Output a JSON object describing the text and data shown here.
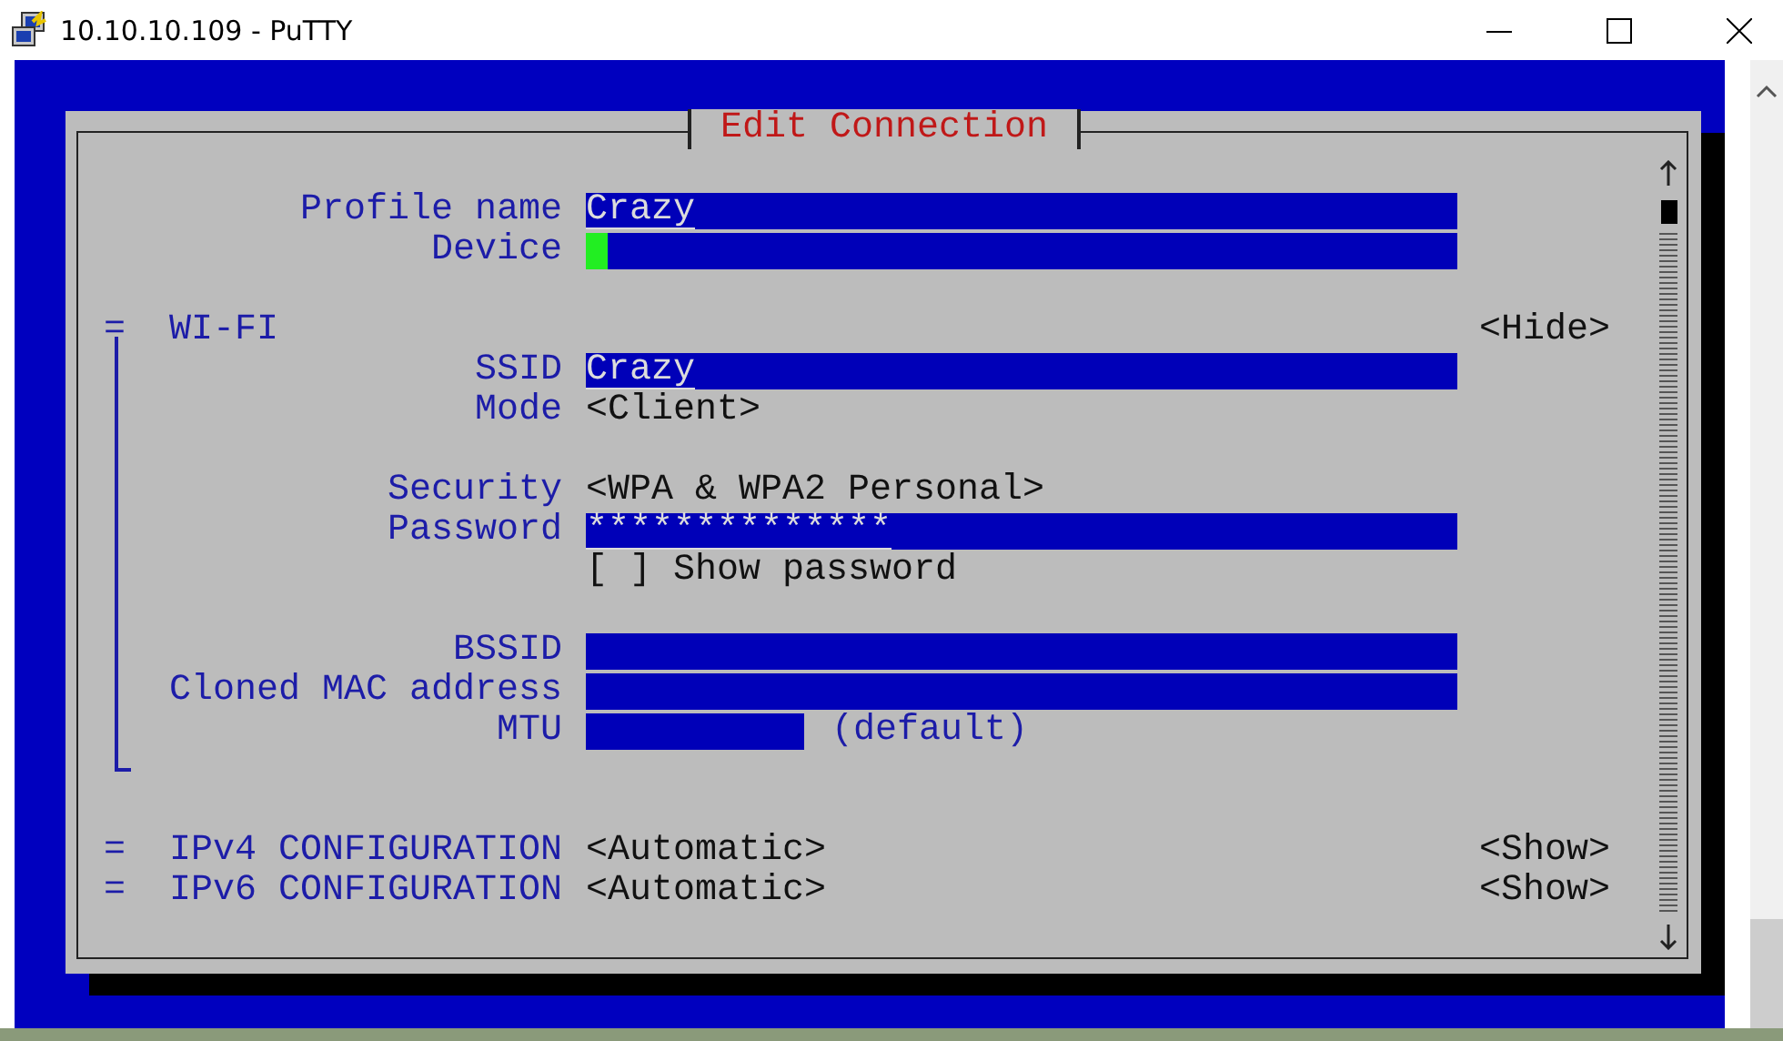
{
  "window": {
    "title": "10.10.10.109 - PuTTY"
  },
  "dialog": {
    "title": "Edit Connection",
    "fields": [
      {
        "label": "Profile name",
        "kind": "input",
        "value": "Crazy",
        "focused": false
      },
      {
        "label": "Device",
        "kind": "input",
        "focused": true
      }
    ],
    "sections": [
      {
        "marker": "=",
        "title": "WI-FI",
        "toggle": "<Hide>",
        "expanded": true,
        "rows": [
          {
            "label": "SSID",
            "kind": "input",
            "value": "Crazy"
          },
          {
            "label": "Mode",
            "kind": "choice",
            "value": "<Client>"
          },
          {
            "kind": "blank"
          },
          {
            "label": "Security",
            "kind": "choice",
            "value": "<WPA & WPA2 Personal>"
          },
          {
            "label": "Password",
            "kind": "input",
            "value": "**************"
          },
          {
            "kind": "checkbox",
            "box": "[ ]",
            "value": "Show password",
            "checked": false
          },
          {
            "kind": "blank"
          },
          {
            "label": "BSSID",
            "kind": "input"
          },
          {
            "label": "Cloned MAC address",
            "kind": "input"
          },
          {
            "label": "MTU",
            "kind": "short-input",
            "suffix": "(default)"
          }
        ]
      },
      {
        "marker": "=",
        "title": "IPv4 CONFIGURATION",
        "value": "<Automatic>",
        "toggle": "<Show>",
        "expanded": false
      },
      {
        "marker": "=",
        "title": "IPv6 CONFIGURATION",
        "value": "<Automatic>",
        "toggle": "<Show>",
        "expanded": false
      }
    ]
  }
}
